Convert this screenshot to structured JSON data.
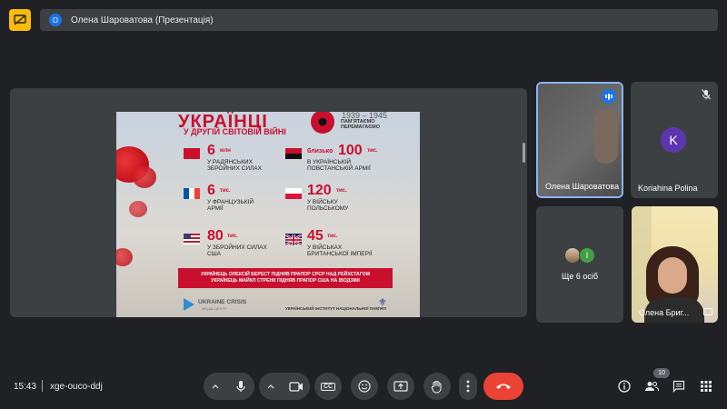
{
  "header": {
    "presenter_badge": "О",
    "presenter_text": "Олена Шароватова (Презентація)"
  },
  "slide": {
    "title": "УКРАЇНЦІ",
    "subtitle": "У ДРУГІЙ СВІТОВІЙ ВІЙНІ",
    "years": "1939 – 1945",
    "remember": "ПАМ'ЯТАЄМО ПЕРЕМАГАЄМО",
    "stats": [
      {
        "num": "6",
        "unit": "млн",
        "desc1": "У РАДЯНСЬКИХ",
        "desc2": "ЗБРОЙНИХ СИЛАХ",
        "flag": "ussr"
      },
      {
        "num": "100",
        "unit": "тис.",
        "prefix": "близько",
        "desc1": "В УКРАЇНСЬКІЙ",
        "desc2": "ПОВСТАНСЬКІЙ АРМІЇ",
        "flag": "upa"
      },
      {
        "num": "6",
        "unit": "тис.",
        "desc1": "У ФРАНЦУЗЬКІЙ",
        "desc2": "АРМІЇ",
        "flag": "france"
      },
      {
        "num": "120",
        "unit": "тис.",
        "desc1": "У ВІЙСЬКУ",
        "desc2": "ПОЛЬСЬКОМУ",
        "flag": "poland"
      },
      {
        "num": "80",
        "unit": "тис.",
        "desc1": "У ЗБРОЙНИХ СИЛАХ",
        "desc2": "США",
        "flag": "usa"
      },
      {
        "num": "45",
        "unit": "тис.",
        "desc1": "У ВІЙСЬКАХ",
        "desc2": "БРИТАНСЬКОЇ ІМПЕРІЇ",
        "flag": "uk"
      }
    ],
    "banner_line1": "УКРАЇНЕЦЬ ОЛЕКСІЙ БЕРЕСТ ПІДНЯВ ПРАПОР СРСР НАД РЕЙХСТАГОМ",
    "banner_line2": "УКРАЇНЕЦЬ МАЙКЛ СТРЕНК ПІДНЯВ ПРАПОР США НА ІВОДЗІМІ",
    "footer_org": "UKRAINE CRISIS",
    "footer_org_sub": "МЕДІА-ЦЕНТР",
    "footer_institute": "УКРАЇНСЬКИЙ ІНСТИТУТ НАЦІОНАЛЬНОЇ ПАМ'ЯТІ"
  },
  "participants": {
    "tile1_name": "Олена Шароватова",
    "tile2_initial": "K",
    "tile2_name": "Koriahina Polina",
    "tile3_initial": "І",
    "tile3_more": "Ще 6 осіб",
    "tile4_name": "Олена Бриг..."
  },
  "bottom": {
    "time": "15:43",
    "meeting_code": "xge-ouco-ddj",
    "captions_label": "CC",
    "people_count": "10"
  },
  "colors": {
    "accent": "#8ab4f8",
    "leave": "#ea4335",
    "present_icon": "#fbbc04",
    "slide_red": "#c8102e"
  },
  "icons": [
    "present-off-icon",
    "mic-icon",
    "camera-icon",
    "captions-icon",
    "emoji-icon",
    "present-screen-icon",
    "raise-hand-icon",
    "more-icon",
    "end-call-icon",
    "info-icon",
    "people-icon",
    "chat-icon",
    "activities-icon"
  ]
}
